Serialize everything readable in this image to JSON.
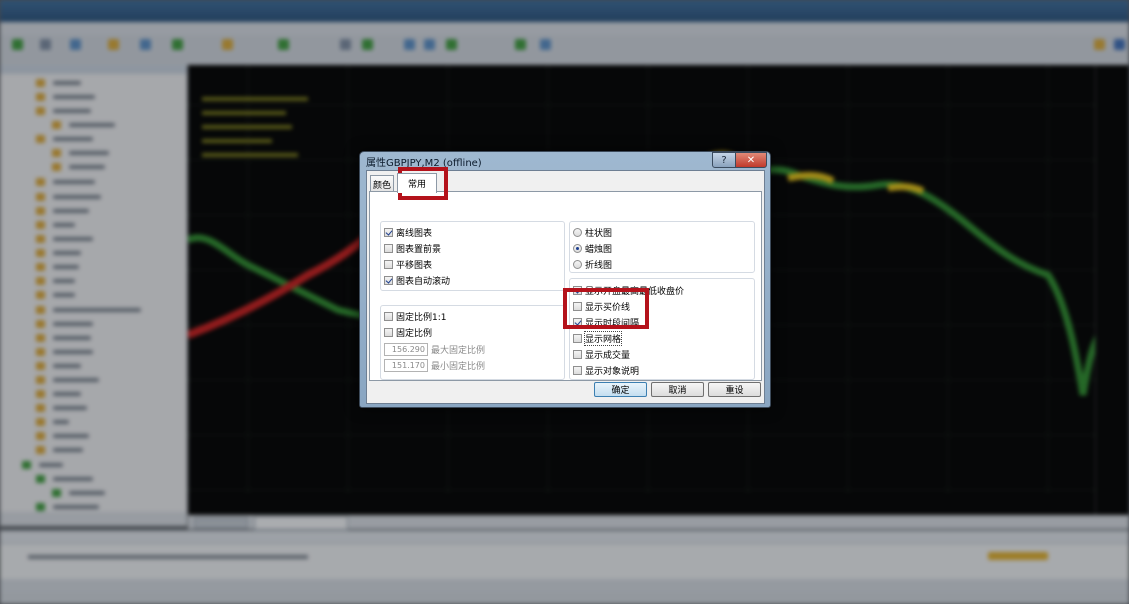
{
  "dialog": {
    "title": "属性GBPJPY,M2 (offline)",
    "help_label": "?",
    "close_label": "✕",
    "tabs": [
      {
        "label": "颜色",
        "active": false
      },
      {
        "label": "常用",
        "active": true
      }
    ],
    "chart_options": [
      {
        "label": "离线图表",
        "checked": true
      },
      {
        "label": "图表置前景",
        "checked": false
      },
      {
        "label": "平移图表",
        "checked": false
      },
      {
        "label": "图表自动滚动",
        "checked": true
      }
    ],
    "scale_options": [
      {
        "label": "固定比例1:1",
        "checked": false
      },
      {
        "label": "固定比例",
        "checked": false
      }
    ],
    "fixed_max": {
      "value": "156.290",
      "label": "最大固定比例"
    },
    "fixed_min": {
      "value": "151.170",
      "label": "最小固定比例"
    },
    "chart_types": [
      {
        "label": "柱状图",
        "selected": false
      },
      {
        "label": "蜡烛图",
        "selected": true
      },
      {
        "label": "折线图",
        "selected": false
      }
    ],
    "display_options": [
      {
        "label": "显示开盘最高最低收盘价",
        "checked": true
      },
      {
        "label": "显示买价线",
        "checked": false
      },
      {
        "label": "显示时段间隔",
        "checked": true
      },
      {
        "label": "显示网格",
        "checked": false
      },
      {
        "label": "显示成交量",
        "checked": false
      },
      {
        "label": "显示对象说明",
        "checked": false
      }
    ],
    "buttons": {
      "ok": "确定",
      "cancel": "取消",
      "reset": "重设"
    }
  },
  "colors": {
    "chart_background": "#000000",
    "highlight_box": "#b4121b",
    "series_up": "#2f8f2f",
    "series_down": "#cc1f1f",
    "series_mid": "#e6c318"
  }
}
